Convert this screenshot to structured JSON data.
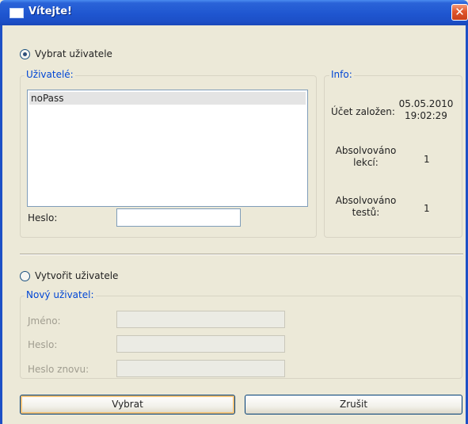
{
  "window": {
    "title": "Vítejte!"
  },
  "select_mode": {
    "radio_label": "Vybrat uživatele",
    "checked": true,
    "users_group": {
      "legend": "Uživatelé:",
      "items": [
        "noPass"
      ],
      "password_label": "Heslo:",
      "password_value": ""
    },
    "info_group": {
      "legend": "Info:",
      "account_created_label": "Účet založen:",
      "account_created_date": "05.05.2010",
      "account_created_time": "19:02:29",
      "lessons_label_1": "Absolvováno",
      "lessons_label_2": "lekcí:",
      "lessons_value": "1",
      "tests_label_1": "Absolvováno",
      "tests_label_2": "testů:",
      "tests_value": "1"
    }
  },
  "create_mode": {
    "radio_label": "Vytvořit uživatele",
    "checked": false,
    "new_user_group": {
      "legend": "Nový uživatel:",
      "name_label": "Jméno:",
      "password_label": "Heslo:",
      "password_again_label": "Heslo znovu:"
    }
  },
  "buttons": {
    "select": "Vybrat",
    "cancel": "Zrušit"
  }
}
